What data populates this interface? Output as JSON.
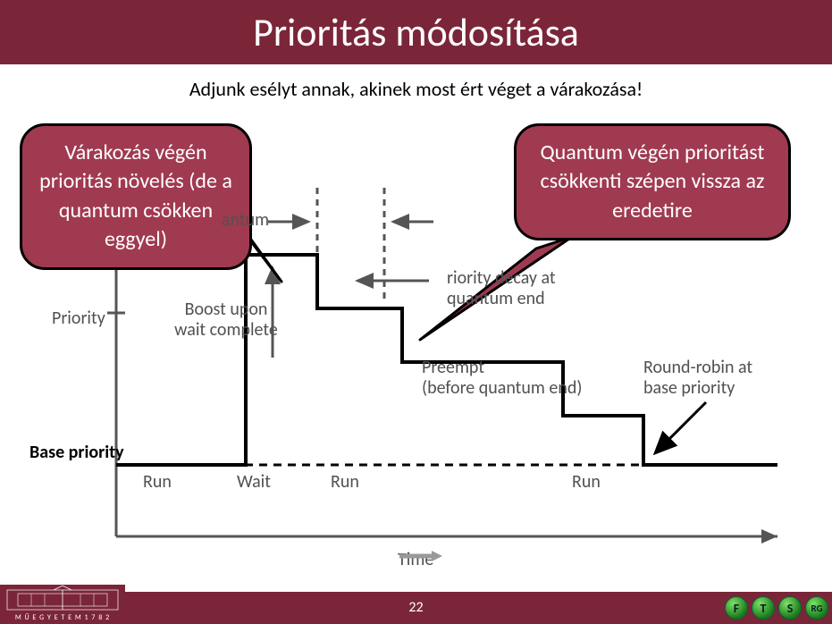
{
  "title": "Prioritás módosítása",
  "subtitle": "Adjunk esélyt annak, akinek most ért véget a várakozása!",
  "callouts": {
    "left": "Várakozás végén prioritás növelés (de a quantum csökken eggyel)",
    "right": "Quantum végén prioritást csökkenti szépen vissza az eredetire"
  },
  "labels": {
    "quantum": "antum",
    "priority": "Priority",
    "base_priority": "Base priority",
    "boost": "Boost upon wait complete",
    "decay_l1": "riority decay at",
    "decay_l2": "quantum end",
    "preempt_l1": "Preempt",
    "preempt_l2": "(before quantum end)",
    "roundrobin_l1": "Round-robin at",
    "roundrobin_l2": "base priority",
    "run1": "Run",
    "wait": "Wait",
    "run2": "Run",
    "run3": "Run",
    "time": "Time"
  },
  "footer": {
    "page": "22",
    "left_text": "M Ű E G Y E T E M  1 7 8 2",
    "badges": [
      "F",
      "T",
      "S",
      "RG"
    ]
  }
}
